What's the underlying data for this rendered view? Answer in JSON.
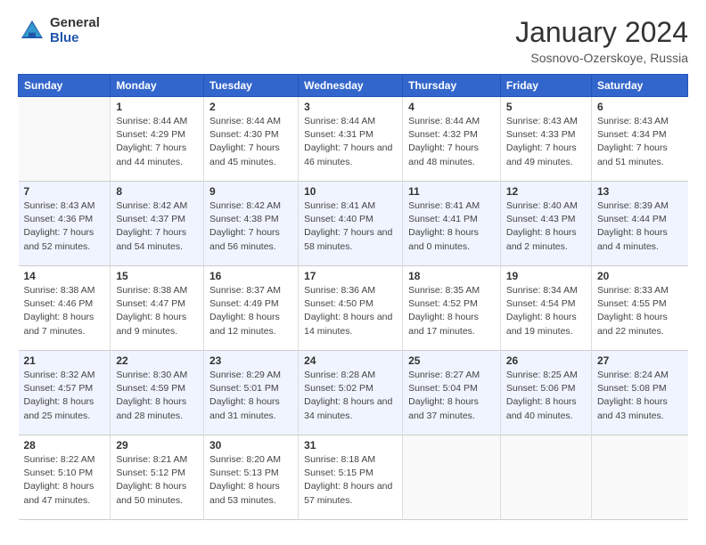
{
  "header": {
    "logo": {
      "general": "General",
      "blue": "Blue"
    },
    "title": "January 2024",
    "location": "Sosnovo-Ozerskoye, Russia"
  },
  "weekdays": [
    "Sunday",
    "Monday",
    "Tuesday",
    "Wednesday",
    "Thursday",
    "Friday",
    "Saturday"
  ],
  "weeks": [
    [
      {
        "day": "",
        "sunrise": "",
        "sunset": "",
        "daylight": ""
      },
      {
        "day": "1",
        "sunrise": "Sunrise: 8:44 AM",
        "sunset": "Sunset: 4:29 PM",
        "daylight": "Daylight: 7 hours and 44 minutes."
      },
      {
        "day": "2",
        "sunrise": "Sunrise: 8:44 AM",
        "sunset": "Sunset: 4:30 PM",
        "daylight": "Daylight: 7 hours and 45 minutes."
      },
      {
        "day": "3",
        "sunrise": "Sunrise: 8:44 AM",
        "sunset": "Sunset: 4:31 PM",
        "daylight": "Daylight: 7 hours and 46 minutes."
      },
      {
        "day": "4",
        "sunrise": "Sunrise: 8:44 AM",
        "sunset": "Sunset: 4:32 PM",
        "daylight": "Daylight: 7 hours and 48 minutes."
      },
      {
        "day": "5",
        "sunrise": "Sunrise: 8:43 AM",
        "sunset": "Sunset: 4:33 PM",
        "daylight": "Daylight: 7 hours and 49 minutes."
      },
      {
        "day": "6",
        "sunrise": "Sunrise: 8:43 AM",
        "sunset": "Sunset: 4:34 PM",
        "daylight": "Daylight: 7 hours and 51 minutes."
      }
    ],
    [
      {
        "day": "7",
        "sunrise": "Sunrise: 8:43 AM",
        "sunset": "Sunset: 4:36 PM",
        "daylight": "Daylight: 7 hours and 52 minutes."
      },
      {
        "day": "8",
        "sunrise": "Sunrise: 8:42 AM",
        "sunset": "Sunset: 4:37 PM",
        "daylight": "Daylight: 7 hours and 54 minutes."
      },
      {
        "day": "9",
        "sunrise": "Sunrise: 8:42 AM",
        "sunset": "Sunset: 4:38 PM",
        "daylight": "Daylight: 7 hours and 56 minutes."
      },
      {
        "day": "10",
        "sunrise": "Sunrise: 8:41 AM",
        "sunset": "Sunset: 4:40 PM",
        "daylight": "Daylight: 7 hours and 58 minutes."
      },
      {
        "day": "11",
        "sunrise": "Sunrise: 8:41 AM",
        "sunset": "Sunset: 4:41 PM",
        "daylight": "Daylight: 8 hours and 0 minutes."
      },
      {
        "day": "12",
        "sunrise": "Sunrise: 8:40 AM",
        "sunset": "Sunset: 4:43 PM",
        "daylight": "Daylight: 8 hours and 2 minutes."
      },
      {
        "day": "13",
        "sunrise": "Sunrise: 8:39 AM",
        "sunset": "Sunset: 4:44 PM",
        "daylight": "Daylight: 8 hours and 4 minutes."
      }
    ],
    [
      {
        "day": "14",
        "sunrise": "Sunrise: 8:38 AM",
        "sunset": "Sunset: 4:46 PM",
        "daylight": "Daylight: 8 hours and 7 minutes."
      },
      {
        "day": "15",
        "sunrise": "Sunrise: 8:38 AM",
        "sunset": "Sunset: 4:47 PM",
        "daylight": "Daylight: 8 hours and 9 minutes."
      },
      {
        "day": "16",
        "sunrise": "Sunrise: 8:37 AM",
        "sunset": "Sunset: 4:49 PM",
        "daylight": "Daylight: 8 hours and 12 minutes."
      },
      {
        "day": "17",
        "sunrise": "Sunrise: 8:36 AM",
        "sunset": "Sunset: 4:50 PM",
        "daylight": "Daylight: 8 hours and 14 minutes."
      },
      {
        "day": "18",
        "sunrise": "Sunrise: 8:35 AM",
        "sunset": "Sunset: 4:52 PM",
        "daylight": "Daylight: 8 hours and 17 minutes."
      },
      {
        "day": "19",
        "sunrise": "Sunrise: 8:34 AM",
        "sunset": "Sunset: 4:54 PM",
        "daylight": "Daylight: 8 hours and 19 minutes."
      },
      {
        "day": "20",
        "sunrise": "Sunrise: 8:33 AM",
        "sunset": "Sunset: 4:55 PM",
        "daylight": "Daylight: 8 hours and 22 minutes."
      }
    ],
    [
      {
        "day": "21",
        "sunrise": "Sunrise: 8:32 AM",
        "sunset": "Sunset: 4:57 PM",
        "daylight": "Daylight: 8 hours and 25 minutes."
      },
      {
        "day": "22",
        "sunrise": "Sunrise: 8:30 AM",
        "sunset": "Sunset: 4:59 PM",
        "daylight": "Daylight: 8 hours and 28 minutes."
      },
      {
        "day": "23",
        "sunrise": "Sunrise: 8:29 AM",
        "sunset": "Sunset: 5:01 PM",
        "daylight": "Daylight: 8 hours and 31 minutes."
      },
      {
        "day": "24",
        "sunrise": "Sunrise: 8:28 AM",
        "sunset": "Sunset: 5:02 PM",
        "daylight": "Daylight: 8 hours and 34 minutes."
      },
      {
        "day": "25",
        "sunrise": "Sunrise: 8:27 AM",
        "sunset": "Sunset: 5:04 PM",
        "daylight": "Daylight: 8 hours and 37 minutes."
      },
      {
        "day": "26",
        "sunrise": "Sunrise: 8:25 AM",
        "sunset": "Sunset: 5:06 PM",
        "daylight": "Daylight: 8 hours and 40 minutes."
      },
      {
        "day": "27",
        "sunrise": "Sunrise: 8:24 AM",
        "sunset": "Sunset: 5:08 PM",
        "daylight": "Daylight: 8 hours and 43 minutes."
      }
    ],
    [
      {
        "day": "28",
        "sunrise": "Sunrise: 8:22 AM",
        "sunset": "Sunset: 5:10 PM",
        "daylight": "Daylight: 8 hours and 47 minutes."
      },
      {
        "day": "29",
        "sunrise": "Sunrise: 8:21 AM",
        "sunset": "Sunset: 5:12 PM",
        "daylight": "Daylight: 8 hours and 50 minutes."
      },
      {
        "day": "30",
        "sunrise": "Sunrise: 8:20 AM",
        "sunset": "Sunset: 5:13 PM",
        "daylight": "Daylight: 8 hours and 53 minutes."
      },
      {
        "day": "31",
        "sunrise": "Sunrise: 8:18 AM",
        "sunset": "Sunset: 5:15 PM",
        "daylight": "Daylight: 8 hours and 57 minutes."
      },
      {
        "day": "",
        "sunrise": "",
        "sunset": "",
        "daylight": ""
      },
      {
        "day": "",
        "sunrise": "",
        "sunset": "",
        "daylight": ""
      },
      {
        "day": "",
        "sunrise": "",
        "sunset": "",
        "daylight": ""
      }
    ]
  ]
}
